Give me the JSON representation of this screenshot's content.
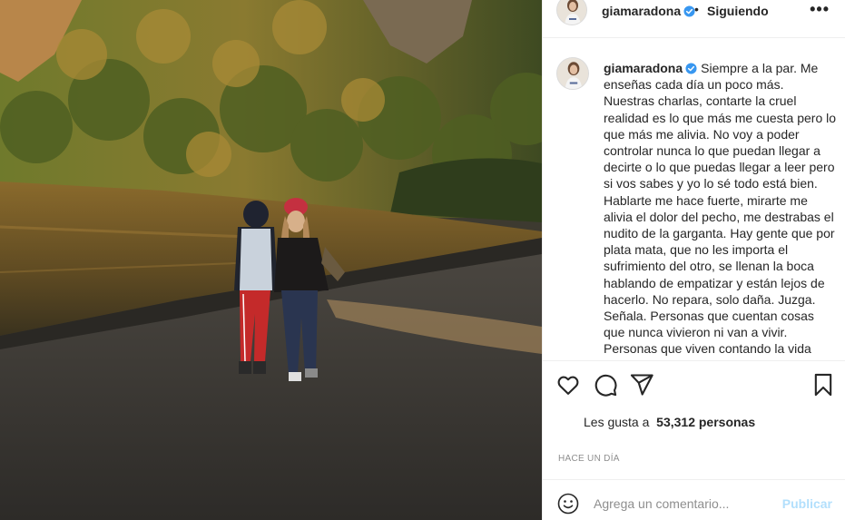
{
  "post": {
    "image_alt": "Two people walking on a dark lakeside beach with a forested hillside in golden light",
    "author": {
      "username": "giamaradona",
      "verified": true,
      "avatar_icon": "profile-avatar"
    },
    "header": {
      "separator": "•",
      "follow_state": "Siguiendo",
      "more_icon": "more-options-icon",
      "more_label": "•••"
    },
    "caption": "Siempre a la par. Me enseñas cada día un poco más. Nuestras charlas, contarte la cruel realidad es lo que más me cuesta pero lo que más me alivia. No voy a poder controlar nunca lo que puedan llegar a decirte o lo que puedas llegar a leer pero si vos sabes y yo lo sé todo está bien. Hablarte me hace fuerte, mirarte me alivia el dolor del pecho, me destrabas el nudito de la garganta. Hay gente que por plata mata, que no les importa el sufrimiento del otro, se llenan la boca hablando de empatizar y están lejos de hacerlo. No repara, solo daña. Juzga. Señala. Personas que cuentan cosas que nunca vivieron ni van a vivir. Personas que viven contando la vida privada de quien nunca conocieron. Enseñan. F...",
    "actions": {
      "like_icon": "heart-icon",
      "comment_icon": "comment-icon",
      "share_icon": "share-icon",
      "save_icon": "bookmark-icon"
    },
    "likes": {
      "prefix": "Les gusta a",
      "count": "53,312 personas"
    },
    "timestamp": "HACE UN DÍA",
    "comment_box": {
      "emoji_icon": "emoji-icon",
      "placeholder": "Agrega un comentario...",
      "publish_label": "Publicar",
      "publish_color": "#b2dffc"
    }
  },
  "colors": {
    "text": "#262626",
    "muted": "#8e8e8e",
    "verified": "#3897f0",
    "border": "#efefef"
  }
}
